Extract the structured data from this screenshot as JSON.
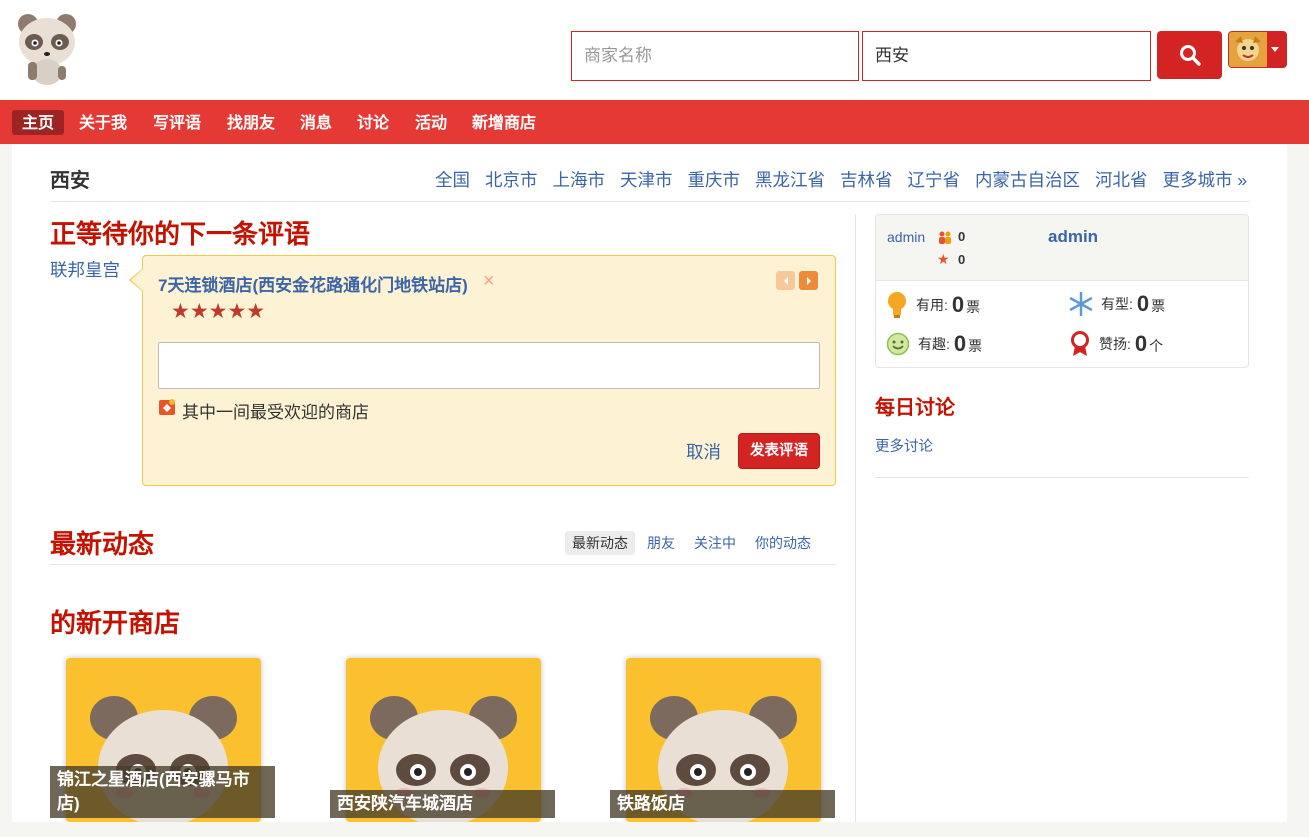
{
  "search": {
    "name_placeholder": "商家名称",
    "location_value": "西安"
  },
  "nav": {
    "items": [
      "主页",
      "关于我",
      "写评语",
      "找朋友",
      "消息",
      "讨论",
      "活动",
      "新增商店"
    ],
    "active": "主页"
  },
  "city": {
    "current": "西安",
    "links": [
      "全国",
      "北京市",
      "上海市",
      "天津市",
      "重庆市",
      "黑龙江省",
      "吉林省",
      "辽宁省",
      "内蒙古自治区",
      "河北省",
      "更多城市 »"
    ]
  },
  "review": {
    "title": "正等待你的下一条评语",
    "business_link": "联邦皇宫",
    "hotel_name": "7天连锁酒店(西安金花路通化门地铁站店)",
    "close": "×",
    "stars": "★★★★★",
    "rating": 5,
    "textarea_value": "",
    "hint": "其中一间最受欢迎的商店",
    "cancel": "取消",
    "submit": "发表评语"
  },
  "feed": {
    "title": "最新动态",
    "tabs": [
      "最新动态",
      "朋友",
      "关注中",
      "你的动态"
    ]
  },
  "new_shops": {
    "title": "的新开商店",
    "items": [
      {
        "name": "锦江之星酒店(西安骡马市店)"
      },
      {
        "name": "西安陕汽车城酒店"
      },
      {
        "name": "铁路饭店"
      }
    ]
  },
  "user": {
    "username_small": "admin",
    "username": "admin",
    "friends_count": "0",
    "reviews_count": "0",
    "stats": [
      {
        "label": "有用:",
        "value": "0",
        "unit": "票",
        "icon": "lightbulb-icon"
      },
      {
        "label": "有型:",
        "value": "0",
        "unit": "票",
        "icon": "snowflake-icon"
      },
      {
        "label": "有趣:",
        "value": "0",
        "unit": "票",
        "icon": "smiley-icon"
      },
      {
        "label": "赞扬:",
        "value": "0",
        "unit": "个",
        "icon": "ribbon-icon"
      }
    ]
  },
  "daily": {
    "title": "每日讨论",
    "more": "更多讨论"
  },
  "colors": {
    "brand_red": "#d32323",
    "nav_red": "#e53935",
    "title_red": "#c41200",
    "link_blue": "#3b65a7"
  }
}
